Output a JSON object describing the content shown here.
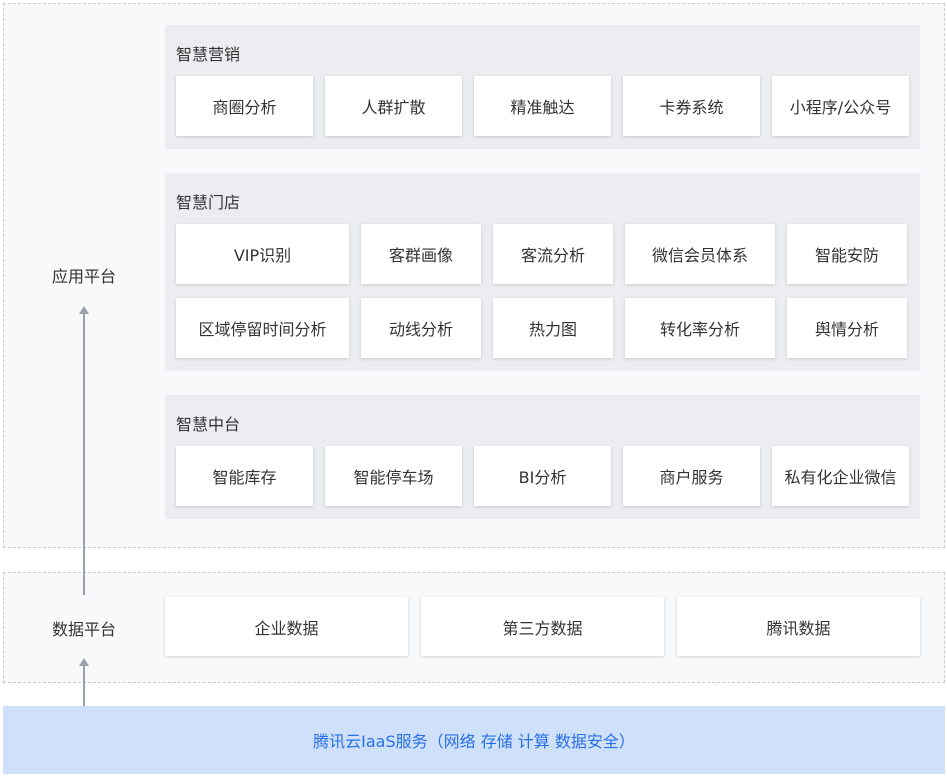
{
  "layers": {
    "app_label": "应用平台",
    "data_label": "数据平台"
  },
  "app_platform": {
    "marketing": {
      "title": "智慧营销",
      "items": [
        "商圈分析",
        "人群扩散",
        "精准触达",
        "卡券系统",
        "小程序/公众号"
      ]
    },
    "store": {
      "title": "智慧门店",
      "row1": [
        "VIP识别",
        "客群画像",
        "客流分析",
        "微信会员体系",
        "智能安防"
      ],
      "row2": [
        "区域停留时间分析",
        "动线分析",
        "热力图",
        "转化率分析",
        "舆情分析"
      ]
    },
    "middle": {
      "title": "智慧中台",
      "items": [
        "智能库存",
        "智能停车场",
        "BI分析",
        "商户服务",
        "私有化企业微信"
      ]
    }
  },
  "data_platform": {
    "items": [
      "企业数据",
      "第三方数据",
      "腾讯数据"
    ]
  },
  "iaas": {
    "text": "腾讯云IaaS服务（网络 存储 计算 数据安全）"
  },
  "colors": {
    "panel_bg": "#ebedf0",
    "cell_bg": "#ffffff",
    "iaas_bg": "#cfe0fb",
    "iaas_text": "#2870e6",
    "arrow": "#9aa0a8",
    "dashed_border": "#c9cdd4"
  }
}
